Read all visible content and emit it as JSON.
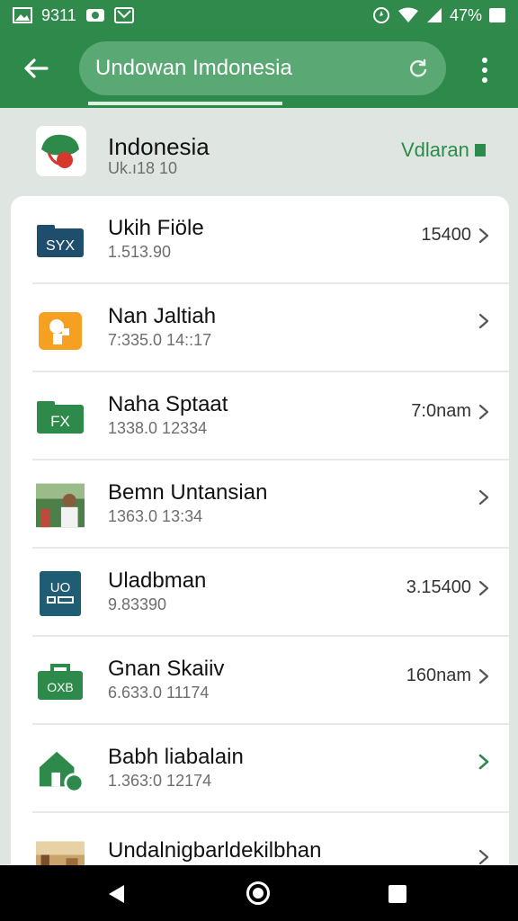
{
  "status_bar": {
    "left_label": "9311",
    "right_text": "47%"
  },
  "app_bar": {
    "search_text": "Undowan Imdonesia"
  },
  "header": {
    "title": "Indonesia",
    "subtitle": "Uk.ı18 10",
    "action_label": "Vdlaran"
  },
  "colors": {
    "primary": "#2e8a4a",
    "search_bg": "#5aa873",
    "accent_orange": "#f5a020",
    "accent_navy": "#1f4e6d",
    "accent_teal": "#1e5d73"
  },
  "list": [
    {
      "title": "Ukih Fiöle",
      "subtitle": "1.513.90",
      "meta": "15400",
      "icon": "file-badge-icon",
      "icon_text": "SYX"
    },
    {
      "title": "Nan Jaltiah",
      "subtitle": "7:335.0 14::17",
      "meta": "",
      "icon": "orange-folder-icon"
    },
    {
      "title": "Naha Sptaat",
      "subtitle": "1338.0 12334",
      "meta": "7:0nam",
      "icon": "green-badge-icon",
      "icon_text": "FX"
    },
    {
      "title": "Bemn Untansian",
      "subtitle": "1363.0 13:34",
      "meta": "",
      "icon": "person-photo-icon"
    },
    {
      "title": "Uladbman",
      "subtitle": "9.83390",
      "meta": "3.15400",
      "icon": "document-grid-icon",
      "icon_text": "UO"
    },
    {
      "title": "Gnan Skaiiv",
      "subtitle": "6.633.0 11174",
      "meta": "160nam",
      "icon": "briefcase-icon",
      "icon_text": "OXB"
    },
    {
      "title": "Babh liabalain",
      "subtitle": "1.363:0 12174",
      "meta": "",
      "icon": "home-icon"
    },
    {
      "title": "Undalnigbarldekilbhan",
      "subtitle": "",
      "meta": "",
      "icon": "landscape-photo-icon"
    }
  ]
}
